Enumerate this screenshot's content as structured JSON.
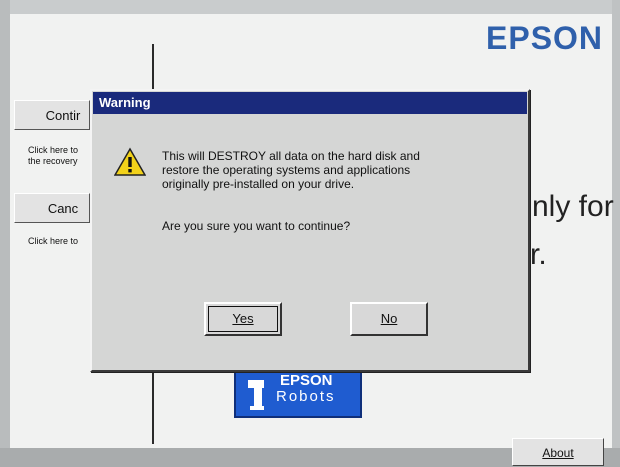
{
  "brand": {
    "text": "EPSON"
  },
  "sidebar": {
    "continue_label": "Contir",
    "continue_desc_1": "Click here to",
    "continue_desc_2": "the recovery",
    "cancel_label": "Canc",
    "cancel_desc": "Click here to"
  },
  "background_text": {
    "line1": "nly for",
    "line2": "r."
  },
  "logo": {
    "top": "EPSON",
    "bottom": "Robots"
  },
  "about_button": {
    "label": "About"
  },
  "dialog": {
    "title": "Warning",
    "message_lines": [
      "This will DESTROY all data on the hard disk and",
      "restore the operating systems and applications",
      "originally pre-installed on your drive."
    ],
    "question": "Are you sure you want to continue?",
    "yes_label": "Yes",
    "no_label": "No"
  },
  "icons": [
    "warning-icon",
    "epson-robot-logo-icon"
  ],
  "colors": {
    "title_bar": "#1a2a7c",
    "brand_blue": "#2f60ab",
    "logo_blue": "#1f5cd0",
    "warning_yellow": "#f2d21a"
  }
}
